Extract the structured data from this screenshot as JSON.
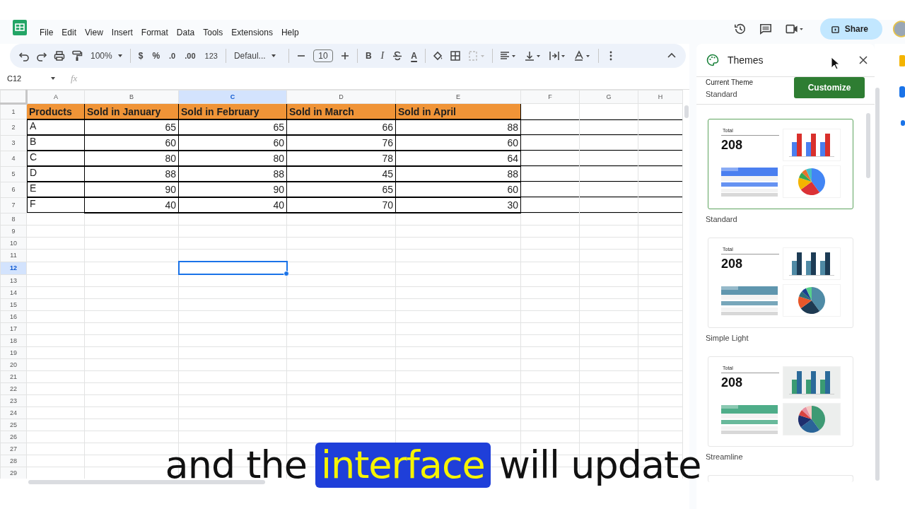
{
  "menu": [
    {
      "label": "File"
    },
    {
      "label": "Edit"
    },
    {
      "label": "View"
    },
    {
      "label": "Insert"
    },
    {
      "label": "Format"
    },
    {
      "label": "Data"
    },
    {
      "label": "Tools"
    },
    {
      "label": "Extensions"
    },
    {
      "label": "Help"
    }
  ],
  "share_button": {
    "label": "Share"
  },
  "toolbar": {
    "zoom": "100%",
    "currency": "$",
    "percent": "%",
    "decimal_decrease": ".0",
    "decimal_increase": ".00",
    "number_format": "123",
    "font": "Defaul...",
    "font_size": "10",
    "bold": "B",
    "italic": "I",
    "text_color": "A"
  },
  "formula_bar": {
    "name_box": "C12",
    "fx": "fx"
  },
  "sheet": {
    "columns": [
      {
        "label": "A",
        "selected": false
      },
      {
        "label": "B",
        "selected": false
      },
      {
        "label": "C",
        "selected": true
      },
      {
        "label": "D",
        "selected": false
      },
      {
        "label": "E",
        "selected": false
      },
      {
        "label": "F",
        "selected": false
      },
      {
        "label": "G",
        "selected": false
      },
      {
        "label": "H",
        "selected": false
      }
    ],
    "rows": [
      {
        "number": "1",
        "selected": false,
        "kind": "header",
        "cells": [
          "Products",
          "Sold in January",
          "Sold in February",
          "Sold in March",
          "Sold in April"
        ]
      },
      {
        "number": "2",
        "selected": false,
        "kind": "data",
        "cells": [
          "A",
          "65",
          "65",
          "66",
          "88"
        ]
      },
      {
        "number": "3",
        "selected": false,
        "kind": "data",
        "cells": [
          "B",
          "60",
          "60",
          "76",
          "60"
        ]
      },
      {
        "number": "4",
        "selected": false,
        "kind": "data",
        "cells": [
          "C",
          "80",
          "80",
          "78",
          "64"
        ]
      },
      {
        "number": "5",
        "selected": false,
        "kind": "data",
        "cells": [
          "D",
          "88",
          "88",
          "45",
          "88"
        ]
      },
      {
        "number": "6",
        "selected": false,
        "kind": "data",
        "cells": [
          "E",
          "90",
          "90",
          "65",
          "60"
        ]
      },
      {
        "number": "7",
        "selected": false,
        "kind": "data",
        "cells": [
          "F",
          "40",
          "40",
          "70",
          "30"
        ]
      },
      {
        "number": "8",
        "selected": false,
        "kind": "empty"
      },
      {
        "number": "9",
        "selected": false,
        "kind": "empty"
      },
      {
        "number": "10",
        "selected": false,
        "kind": "empty"
      },
      {
        "number": "11",
        "selected": false,
        "kind": "empty"
      },
      {
        "number": "12",
        "selected": true,
        "kind": "empty"
      },
      {
        "number": "13",
        "selected": false,
        "kind": "empty"
      },
      {
        "number": "14",
        "selected": false,
        "kind": "empty"
      },
      {
        "number": "15",
        "selected": false,
        "kind": "empty"
      },
      {
        "number": "16",
        "selected": false,
        "kind": "empty"
      },
      {
        "number": "17",
        "selected": false,
        "kind": "empty"
      },
      {
        "number": "18",
        "selected": false,
        "kind": "empty"
      },
      {
        "number": "19",
        "selected": false,
        "kind": "empty"
      },
      {
        "number": "20",
        "selected": false,
        "kind": "empty"
      },
      {
        "number": "21",
        "selected": false,
        "kind": "empty"
      },
      {
        "number": "22",
        "selected": false,
        "kind": "empty"
      },
      {
        "number": "23",
        "selected": false,
        "kind": "empty"
      },
      {
        "number": "24",
        "selected": false,
        "kind": "empty"
      },
      {
        "number": "25",
        "selected": false,
        "kind": "empty"
      },
      {
        "number": "26",
        "selected": false,
        "kind": "empty"
      },
      {
        "number": "27",
        "selected": false,
        "kind": "empty"
      },
      {
        "number": "28",
        "selected": false,
        "kind": "empty"
      },
      {
        "number": "29",
        "selected": false,
        "kind": "empty"
      }
    ]
  },
  "themes_panel": {
    "title": "Themes",
    "current_label": "Current Theme",
    "current_value": "Standard",
    "customize_button": "Customize",
    "themes": [
      {
        "name": "Standard",
        "selected": true,
        "total_label": "Total",
        "total_value": "208",
        "tinted": false,
        "bars": [
          {
            "color": "#4a7ff0"
          },
          {
            "color": "#d9302c"
          }
        ],
        "stripe": {
          "color": "#4a7ff0"
        },
        "pie_slices": [
          {
            "color": "#4285f4"
          },
          {
            "color": "#db3236"
          },
          {
            "color": "#f4b400"
          },
          {
            "color": "#34a853"
          },
          {
            "color": "#e8712a"
          },
          {
            "color": "#46bdc6"
          }
        ]
      },
      {
        "name": "Simple Light",
        "selected": false,
        "total_label": "Total",
        "total_value": "208",
        "tinted": false,
        "bars": [
          {
            "color": "#4f8aa5"
          },
          {
            "color": "#1d3c55"
          }
        ],
        "stripe": {
          "color": "#5f96ae"
        },
        "pie_slices": [
          {
            "color": "#4f8ba6"
          },
          {
            "color": "#1e3a52"
          },
          {
            "color": "#e8572a"
          },
          {
            "color": "#2b6c7a"
          },
          {
            "color": "#1a3f8f"
          },
          {
            "color": "#57d08a"
          }
        ]
      },
      {
        "name": "Streamline",
        "selected": false,
        "total_label": "Total",
        "total_value": "208",
        "tinted": true,
        "bars": [
          {
            "color": "#3a9b73"
          },
          {
            "color": "#2b6a9a"
          }
        ],
        "stripe": {
          "color": "#4ead89"
        },
        "pie_slices": [
          {
            "color": "#3e9a74"
          },
          {
            "color": "#2a6498"
          },
          {
            "color": "#1e2f6e"
          },
          {
            "color": "#d94340"
          },
          {
            "color": "#e88fa0"
          },
          {
            "color": "#f5c6c0"
          }
        ]
      }
    ]
  },
  "caption": {
    "segments": [
      {
        "text": "and the",
        "highlighted": false
      },
      {
        "text": "interface",
        "highlighted": true
      },
      {
        "text": "will update",
        "highlighted": false
      }
    ]
  }
}
